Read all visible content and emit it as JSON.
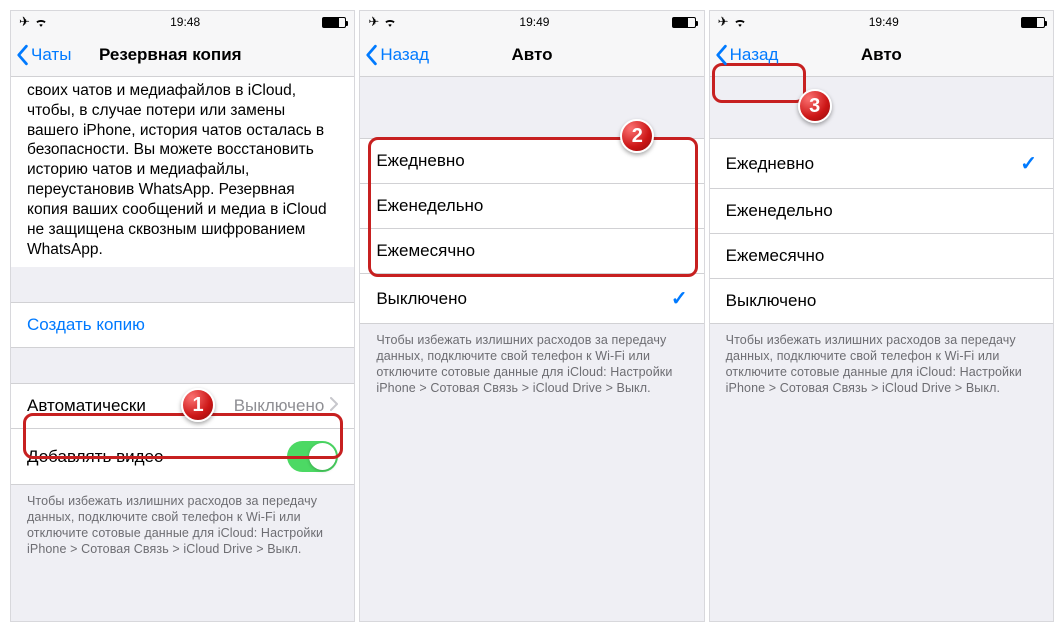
{
  "phones": [
    {
      "status_time": "19:48",
      "nav_back": "Чаты",
      "nav_title": "Резервная копия",
      "paragraph": "своих чатов и медиафайлов в iCloud, чтобы, в случае потери или замены вашего iPhone, история чатов осталась в безопасности. Вы можете восстановить историю чатов и медиафайлы, переустановив WhatsApp. Резервная копия ваших сообщений и медиа в iCloud не защищена сквозным шифрованием WhatsApp.",
      "create_backup": "Создать копию",
      "auto_label": "Автоматически",
      "auto_value": "Выключено",
      "add_video": "Добавлять видео",
      "footer": "Чтобы избежать излишних расходов за передачу данных, подключите свой телефон к Wi-Fi или отключите сотовые данные для iCloud: Настройки iPhone > Сотовая Связь > iCloud Drive > Выкл."
    },
    {
      "status_time": "19:49",
      "nav_back": "Назад",
      "nav_title": "Авто",
      "options": [
        "Ежедневно",
        "Еженедельно",
        "Ежемесячно",
        "Выключено"
      ],
      "selected": "Выключено",
      "footer": "Чтобы избежать излишних расходов за передачу данных, подключите свой телефон к Wi-Fi или отключите сотовые данные для iCloud: Настройки iPhone > Сотовая Связь > iCloud Drive > Выкл."
    },
    {
      "status_time": "19:49",
      "nav_back": "Назад",
      "nav_title": "Авто",
      "options": [
        "Ежедневно",
        "Еженедельно",
        "Ежемесячно",
        "Выключено"
      ],
      "selected": "Ежедневно",
      "footer": "Чтобы избежать излишних расходов за передачу данных, подключите свой телефон к Wi-Fi или отключите сотовые данные для iCloud: Настройки iPhone > Сотовая Связь > iCloud Drive > Выкл."
    }
  ],
  "callouts": [
    "1",
    "2",
    "3"
  ]
}
